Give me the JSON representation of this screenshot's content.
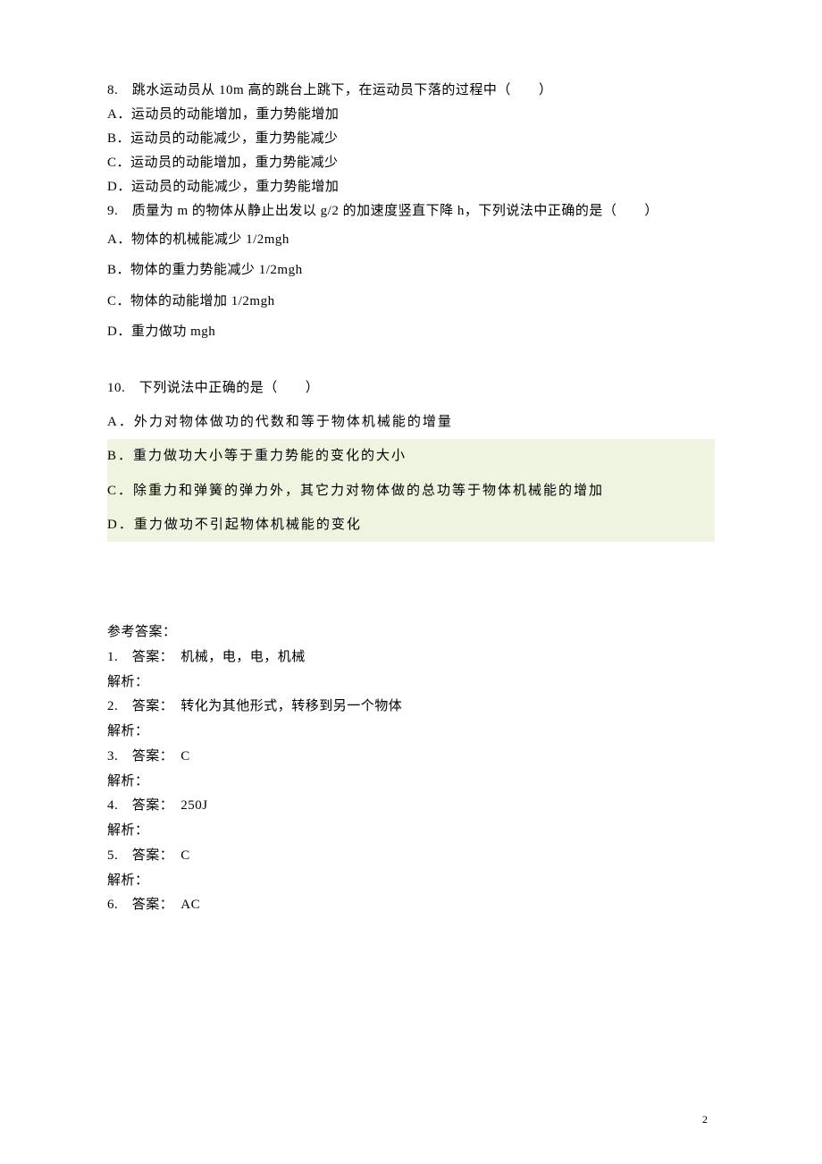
{
  "questions": {
    "q8": {
      "stem": "8.　跳水运动员从 10m 高的跳台上跳下，在运动员下落的过程中（　　）",
      "A": "A．运动员的动能增加，重力势能增加",
      "B": "B．运动员的动能减少，重力势能减少",
      "C": "C．运动员的动能增加，重力势能减少",
      "D": "D．运动员的动能减少，重力势能增加"
    },
    "q9": {
      "stem": "9.　质量为 m 的物体从静止出发以 g/2 的加速度竖直下降 h，下列说法中正确的是（　　）",
      "A": "A．物体的机械能减少 1/2mgh",
      "B": "B．物体的重力势能减少 1/2mgh",
      "C": "C．物体的动能增加 1/2mgh",
      "D": "D．重力做功 mgh"
    },
    "q10": {
      "stem": "10.　下列说法中正确的是（　　）",
      "A": "A．外力对物体做功的代数和等于物体机械能的增量",
      "B": "B．重力做功大小等于重力势能的变化的大小",
      "C": "C．除重力和弹簧的弹力外，其它力对物体做的总功等于物体机械能的增加",
      "D": "D．重力做功不引起物体机械能的变化"
    }
  },
  "answers_header": "参考答案：",
  "answers": [
    {
      "idx": "1.　答案：　机械，电，电，机械",
      "jx": "解析："
    },
    {
      "idx": "2.　答案：　转化为其他形式，转移到另一个物体",
      "jx": "解析："
    },
    {
      "idx": "3.　答案：　C",
      "jx": "解析："
    },
    {
      "idx": "4.　答案：　250J",
      "jx": "解析："
    },
    {
      "idx": "5.　答案：　C",
      "jx": "解析："
    },
    {
      "idx": "6.　答案：　AC",
      "jx": ""
    }
  ],
  "page_number": "2"
}
